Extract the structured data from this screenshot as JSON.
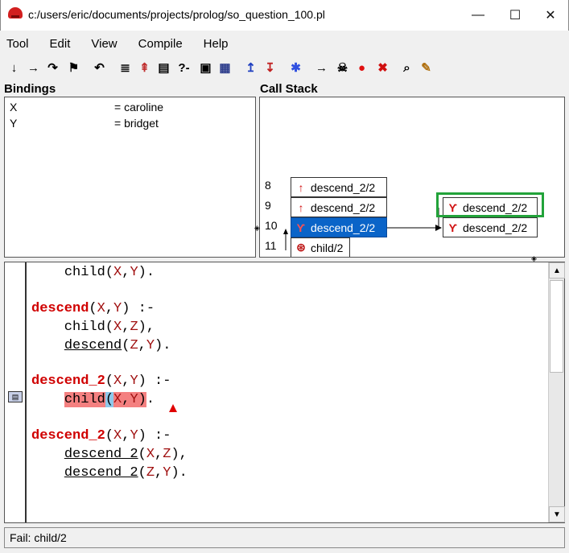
{
  "window": {
    "title": "c:/users/eric/documents/projects/prolog/so_question_100.pl",
    "minimize_glyph": "—",
    "maximize_glyph": "☐",
    "close_glyph": "✕"
  },
  "menu": [
    "Tool",
    "Edit",
    "View",
    "Compile",
    "Help"
  ],
  "toolbar": [
    {
      "icon": "step-into-icon",
      "glyph": "↓"
    },
    {
      "icon": "step-over-icon",
      "glyph": "→"
    },
    {
      "icon": "skip-icon",
      "glyph": "↷"
    },
    {
      "icon": "finish-icon",
      "glyph": "⚑"
    },
    {
      "icon": "retry-icon",
      "glyph": "↶"
    },
    {
      "icon": "nodebug-icon",
      "glyph": "≣"
    },
    {
      "icon": "up-frame-icon",
      "glyph": "⇞"
    },
    {
      "icon": "leap-icon",
      "glyph": "▤"
    },
    {
      "icon": "query-icon",
      "glyph": "?-"
    },
    {
      "icon": "console-icon",
      "glyph": "▣"
    },
    {
      "icon": "editor-icon",
      "glyph": "▦"
    },
    {
      "icon": "stack-up-icon",
      "glyph": "↥"
    },
    {
      "icon": "stack-down-icon",
      "glyph": "↧"
    },
    {
      "icon": "breakpoint-icon",
      "glyph": "✱"
    },
    {
      "icon": "goto-icon",
      "glyph": "→"
    },
    {
      "icon": "spy-icon",
      "glyph": "☠"
    },
    {
      "icon": "stop-icon",
      "glyph": "●"
    },
    {
      "icon": "abort-icon",
      "glyph": "✖"
    },
    {
      "icon": "search-icon",
      "glyph": "⌕"
    },
    {
      "icon": "edit-icon",
      "glyph": "✎"
    }
  ],
  "bindings": {
    "title": "Bindings",
    "rows": [
      {
        "var": "X",
        "value": "= caroline"
      },
      {
        "var": "Y",
        "value": "= bridget"
      }
    ]
  },
  "callstack": {
    "title": "Call Stack",
    "frame_numbers": [
      "8",
      "9",
      "10",
      "11"
    ],
    "frames": [
      {
        "label": "descend_2/2",
        "icon": "call-port-icon",
        "glyph": "↑"
      },
      {
        "label": "descend_2/2",
        "icon": "call-port-icon",
        "glyph": "↑"
      },
      {
        "label": "descend_2/2",
        "icon": "choice-point-icon",
        "glyph": "Ƴ"
      },
      {
        "label": "child/2",
        "icon": "fail-port-icon",
        "glyph": "⊛"
      }
    ],
    "alternatives": [
      {
        "label": "descend_2/2",
        "icon": "choice-point-icon",
        "glyph": "Ƴ"
      },
      {
        "label": "descend_2/2",
        "icon": "choice-point-icon",
        "glyph": "Ƴ"
      }
    ]
  },
  "source": {
    "lines": [
      {
        "indent": "    ",
        "text": "child(X,Y)."
      },
      {
        "indent": "",
        "text": ""
      },
      {
        "indent": "",
        "text": "descend(X,Y) :-"
      },
      {
        "indent": "    ",
        "text": "child(X,Z),"
      },
      {
        "indent": "    ",
        "text": "descend(Z,Y)."
      },
      {
        "indent": "",
        "text": ""
      },
      {
        "indent": "",
        "text": "descend_2(X,Y) :-"
      },
      {
        "indent": "    ",
        "text": "child(X,Y)."
      },
      {
        "indent": "",
        "text": ""
      },
      {
        "indent": "",
        "text": "descend_2(X,Y) :-"
      },
      {
        "indent": "    ",
        "text": "descend_2(X,Z),"
      },
      {
        "indent": "    ",
        "text": "descend_2(Z,Y)."
      }
    ]
  },
  "status": "Fail: child/2",
  "colors": {
    "selected_frame": "#0a64c8",
    "highlight_border": "#22a33a",
    "keyword": "#d00000",
    "current_goal": "#f48080"
  }
}
